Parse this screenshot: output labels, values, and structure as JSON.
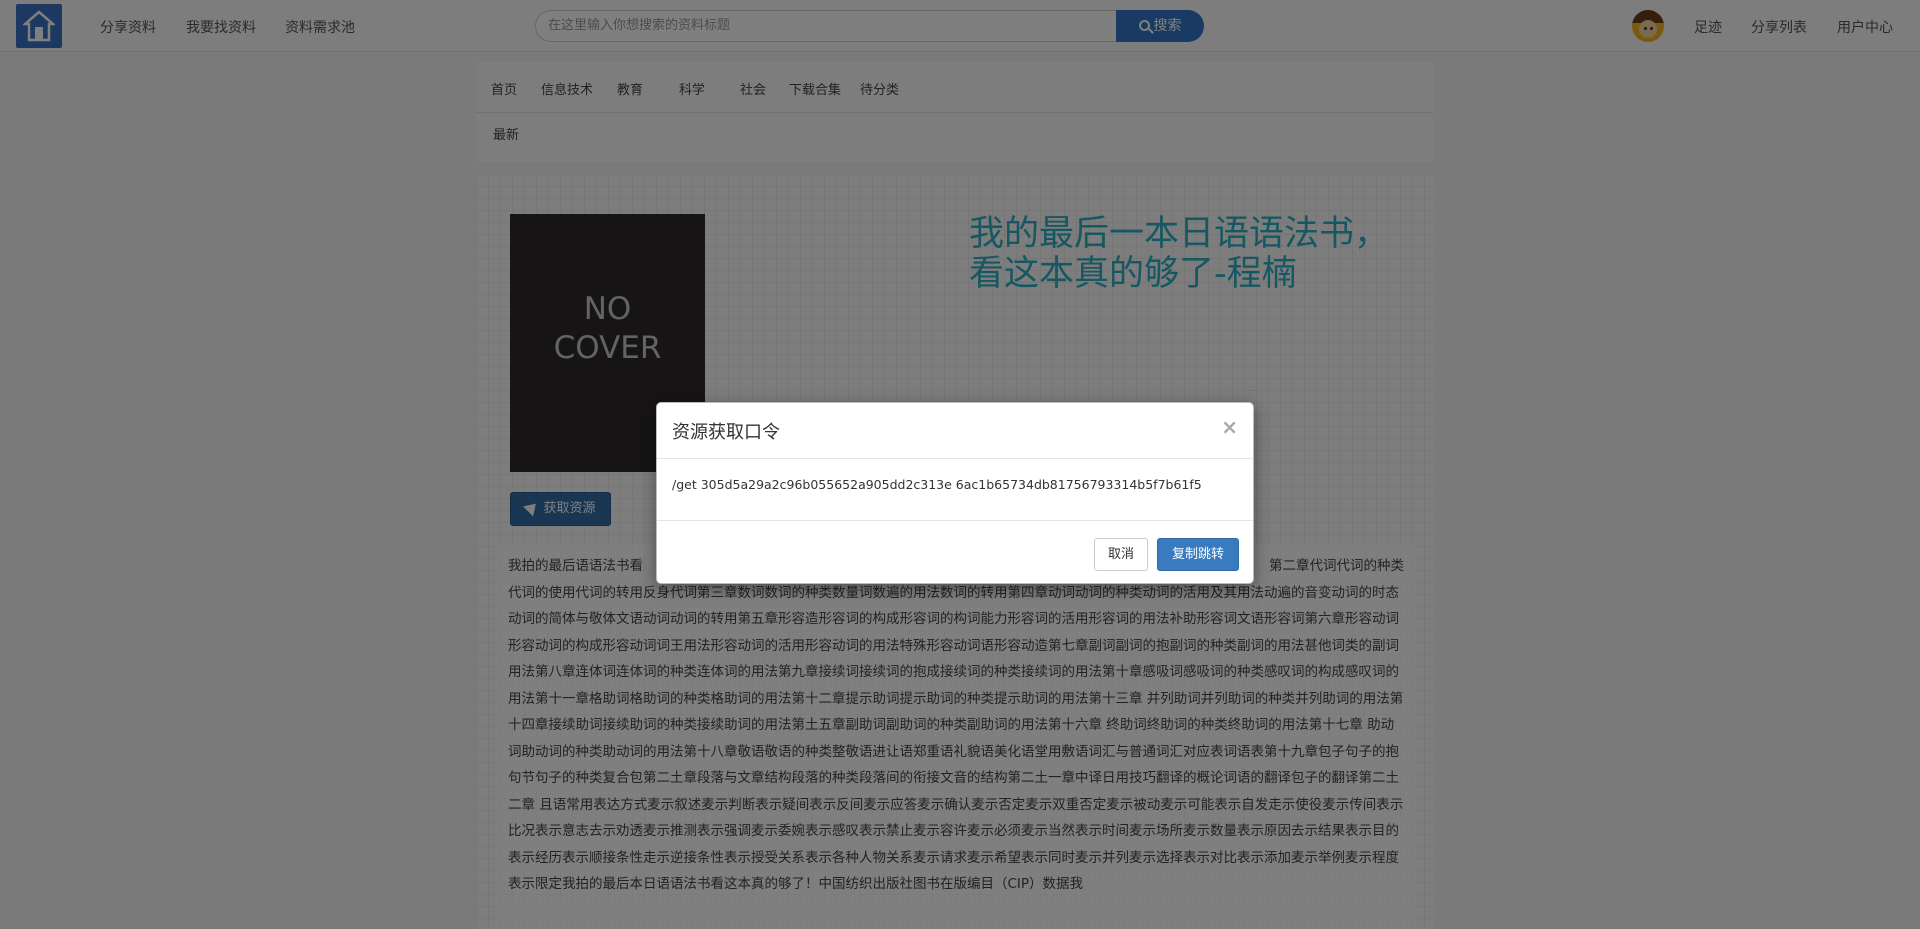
{
  "navbar": {
    "links": [
      "分享资料",
      "我要找资料",
      "资料需求池"
    ],
    "search_placeholder": "在这里输入你想搜索的资料标题",
    "search_button": "搜索",
    "right_links": [
      "足迹",
      "分享列表",
      "用户中心"
    ]
  },
  "categories": {
    "row1": [
      "首页",
      "信息技术",
      "教育",
      "科学",
      "社会",
      "下载合集",
      "待分类"
    ],
    "row2": [
      "最新"
    ]
  },
  "book": {
    "cover_text": "NO COVER",
    "title": "我的最后一本日语语法书，看这本真的够了-程楠",
    "get_button": "获取资源",
    "description_start": "我拍的最后语语法书看",
    "description_right": "第二章代词代词的种类",
    "description": "代词的使用代词的转用反身代词第三章数词数词的种类数量词数遍的用法数词的转用第四章动词动词的种类动词的活用及其用法动遍的音变动词的时态动词的简体与敬体文语动词动词的转用第五章形容造形容词的构成形容词的构词能力形容词的活用形容词的用法补助形容词文语形容词第六章形容动词形容动词的构成形容动词词王用法形容动词的活用形容动词的用法特殊形容动词语形容动造第七章副词副词的抱副词的种类副词的用法甚他词类的副词用法第八章连体词连体词的种类连体词的用法第九章接续词接续词的抱成接续词的种类接续词的用法第十章感吸词感吸词的种类感叹词的构成感叹词的用法第十一章格助词格助词的种类格助词的用法第十二章提示助词提示助词的种类提示助词的用法第十三章 并列助词并列助词的种类并列助词的用法第十四章接续助词接续助词的种类接续助词的用法第土五章副助词副助词的种类副助词的用法第十六章 终助词终助词的种类终助词的用法第十七章 助动词助动词的种类助动词的用法第十八章敬语敬语的种类整敬语进让语郑重语礼貌语美化语堂用敷语词汇与普通词汇对应表词语表第十九章包子句子的抱句节句子的种类复合包第二土章段落与文章结构段落的种类段落间的衔接文音的结构第二土一章中译日用技巧翻译的概论词语的翻译包子的翻译第二土二章 且语常用表达方式麦示叙述麦示判断表示疑间表示反间麦示应答麦示确认麦示否定麦示双重否定麦示被动麦示可能表示自发走示使役麦示传间表示比况表示意志去示劝透麦示推测表示强调麦示委婉表示感叹表示禁止麦示容许麦示必须麦示当然表示时间麦示场所麦示数量表示原因去示结果表示目的表示经历表示顺接条性走示逆接条性表示授受关系表示各种人物关系麦示请求麦示希望表示同时麦示并列麦示选择表示对比表示添加麦示举例麦示程度表示限定我拍的最后本日语语法书看这本真的够了！中国纺织出版社图书在版编目（CIP）数据我"
  },
  "modal": {
    "title": "资源获取口令",
    "close": "×",
    "command": "/get 305d5a29a2c96b055652a905dd2c313e 6ac1b65734db81756793314b5f7b61f5",
    "cancel": "取消",
    "confirm": "复制跳转"
  },
  "colors": {
    "primary": "#3277c6",
    "title": "#2db0c5"
  }
}
